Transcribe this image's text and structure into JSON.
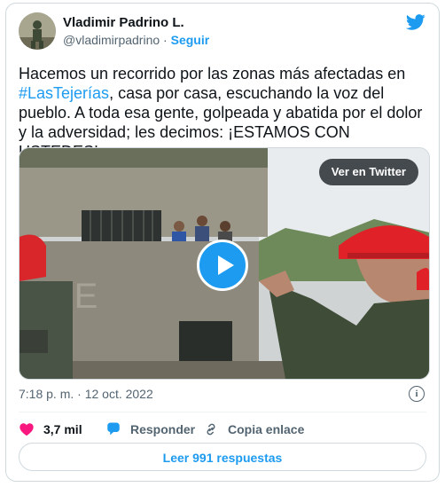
{
  "tweet": {
    "author_name": "Vladimir Padrino L.",
    "handle": "@vladimirpadrino",
    "separator": "·",
    "follow_label": "Seguir",
    "text_before_tag": "Hacemos un recorrido por las zonas más afectadas en ",
    "hashtag": "#LasTejerías",
    "text_after_tag": ", casa por casa, escuchando la voz del pueblo. A toda esa gente, golpeada y abatida por el dolor y la adversidad; les decimos: ¡ESTAMOS CON USTEDES!",
    "timestamp": "7:18 p. m. · 12 oct. 2022"
  },
  "media": {
    "watch_label": "Ver en Twitter",
    "play_icon": "play-icon"
  },
  "actions": {
    "likes_count": "3,7 mil",
    "reply_label": "Responder",
    "copy_label": "Copia enlace"
  },
  "footer": {
    "read_replies_label": "Leer 991 respuestas"
  },
  "colors": {
    "brand": "#1d9bf0",
    "like": "#f91880",
    "text": "#0f1419",
    "muted": "#536471"
  }
}
